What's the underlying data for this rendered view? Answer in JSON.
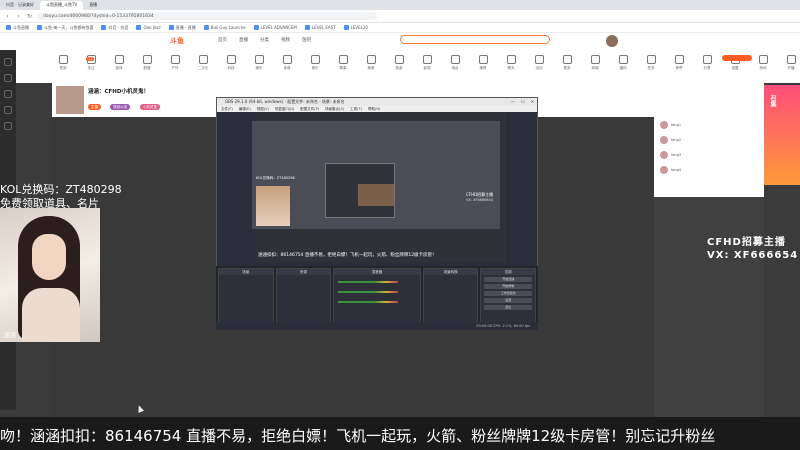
{
  "browser": {
    "tabs": [
      "抖音 - 记录美好",
      "斗鱼直播_斗鱼TV",
      "直播"
    ],
    "url": "douyu.com/4660980/?dyshid=0-1533795801634"
  },
  "bookmarks": [
    "斗鱼直播",
    "斗鱼-每一天，斗鱼都有惊喜",
    "抖音 - 抖音",
    "Oan Jazz",
    "直播 - 直播",
    "Bali Guy Launche",
    "LEVEL ADVANCEM",
    "LEVEL EAST",
    "LEVEL20"
  ],
  "site": {
    "logo": "斗鱼",
    "nav": [
      "首页",
      "直播",
      "分类",
      "视频",
      "鱼吧"
    ],
    "categories": [
      "签到",
      "关注",
      "游戏",
      "颜值",
      "户外",
      "二次元",
      "科技",
      "娱乐",
      "体育",
      "音乐",
      "赛事",
      "美食",
      "旅游",
      "影视",
      "电台",
      "推荐",
      "聊天",
      "活动",
      "更多",
      "商城",
      "福利",
      "任务",
      "荣誉",
      "分享",
      "设置",
      "房间",
      "开播"
    ],
    "category_badge": "12"
  },
  "room": {
    "title": "涵涵：CFHD小机灵鬼！",
    "tags": [
      "主播",
      "穿越火线",
      "小机灵鬼"
    ]
  },
  "ranking": [
    "fang1",
    "fang2",
    "fang3",
    "fang4"
  ],
  "promo_banner": "召集",
  "obs": {
    "window_title": "OBS 29.1.0 (64-bit, windows) - 配置文件: 未命名 - 场景: 未命名",
    "menu": [
      "文件(F)",
      "编辑(E)",
      "视图(V)",
      "停靠窗口(D)",
      "配置文件(P)",
      "场景集合(S)",
      "工具(T)",
      "帮助(H)"
    ],
    "preview_side_text": "CFHD招募主播",
    "preview_id": "VX: XF6666654",
    "preview_cam_label": "KOL兑换码：ZT480298",
    "preview_scroll": "涵涵扣扣：86146754 直播不易，拒绝白嫖！飞机一起玩，火箭、粉丝牌牌12级卡房管！",
    "docks": [
      "场景",
      "来源",
      "混音器",
      "场景转换",
      "控制"
    ],
    "controls": [
      "开始直播",
      "开始录制",
      "工作室模式",
      "设置",
      "退出"
    ],
    "status": "00:00:00 CPU: 2.1%, 60.00 fps"
  },
  "overlay": {
    "kol_code": "KOL兑换码：ZT480298",
    "kol_sub": "免费领取道具、名片",
    "webcam_mark": "涵涵",
    "recruit": "CFHD招募主播",
    "recruit_vx": "VX: XF666654",
    "scroll_text": "吻！涵涵扣扣：86146754 直播不易，拒绝白嫖！飞机一起玩，火箭、粉丝牌牌12级卡房管！别忘记升粉丝"
  },
  "colors": {
    "brand": "#ff5d23",
    "obs_bg": "#2b2e38",
    "page_bg": "#3b3b3b"
  }
}
